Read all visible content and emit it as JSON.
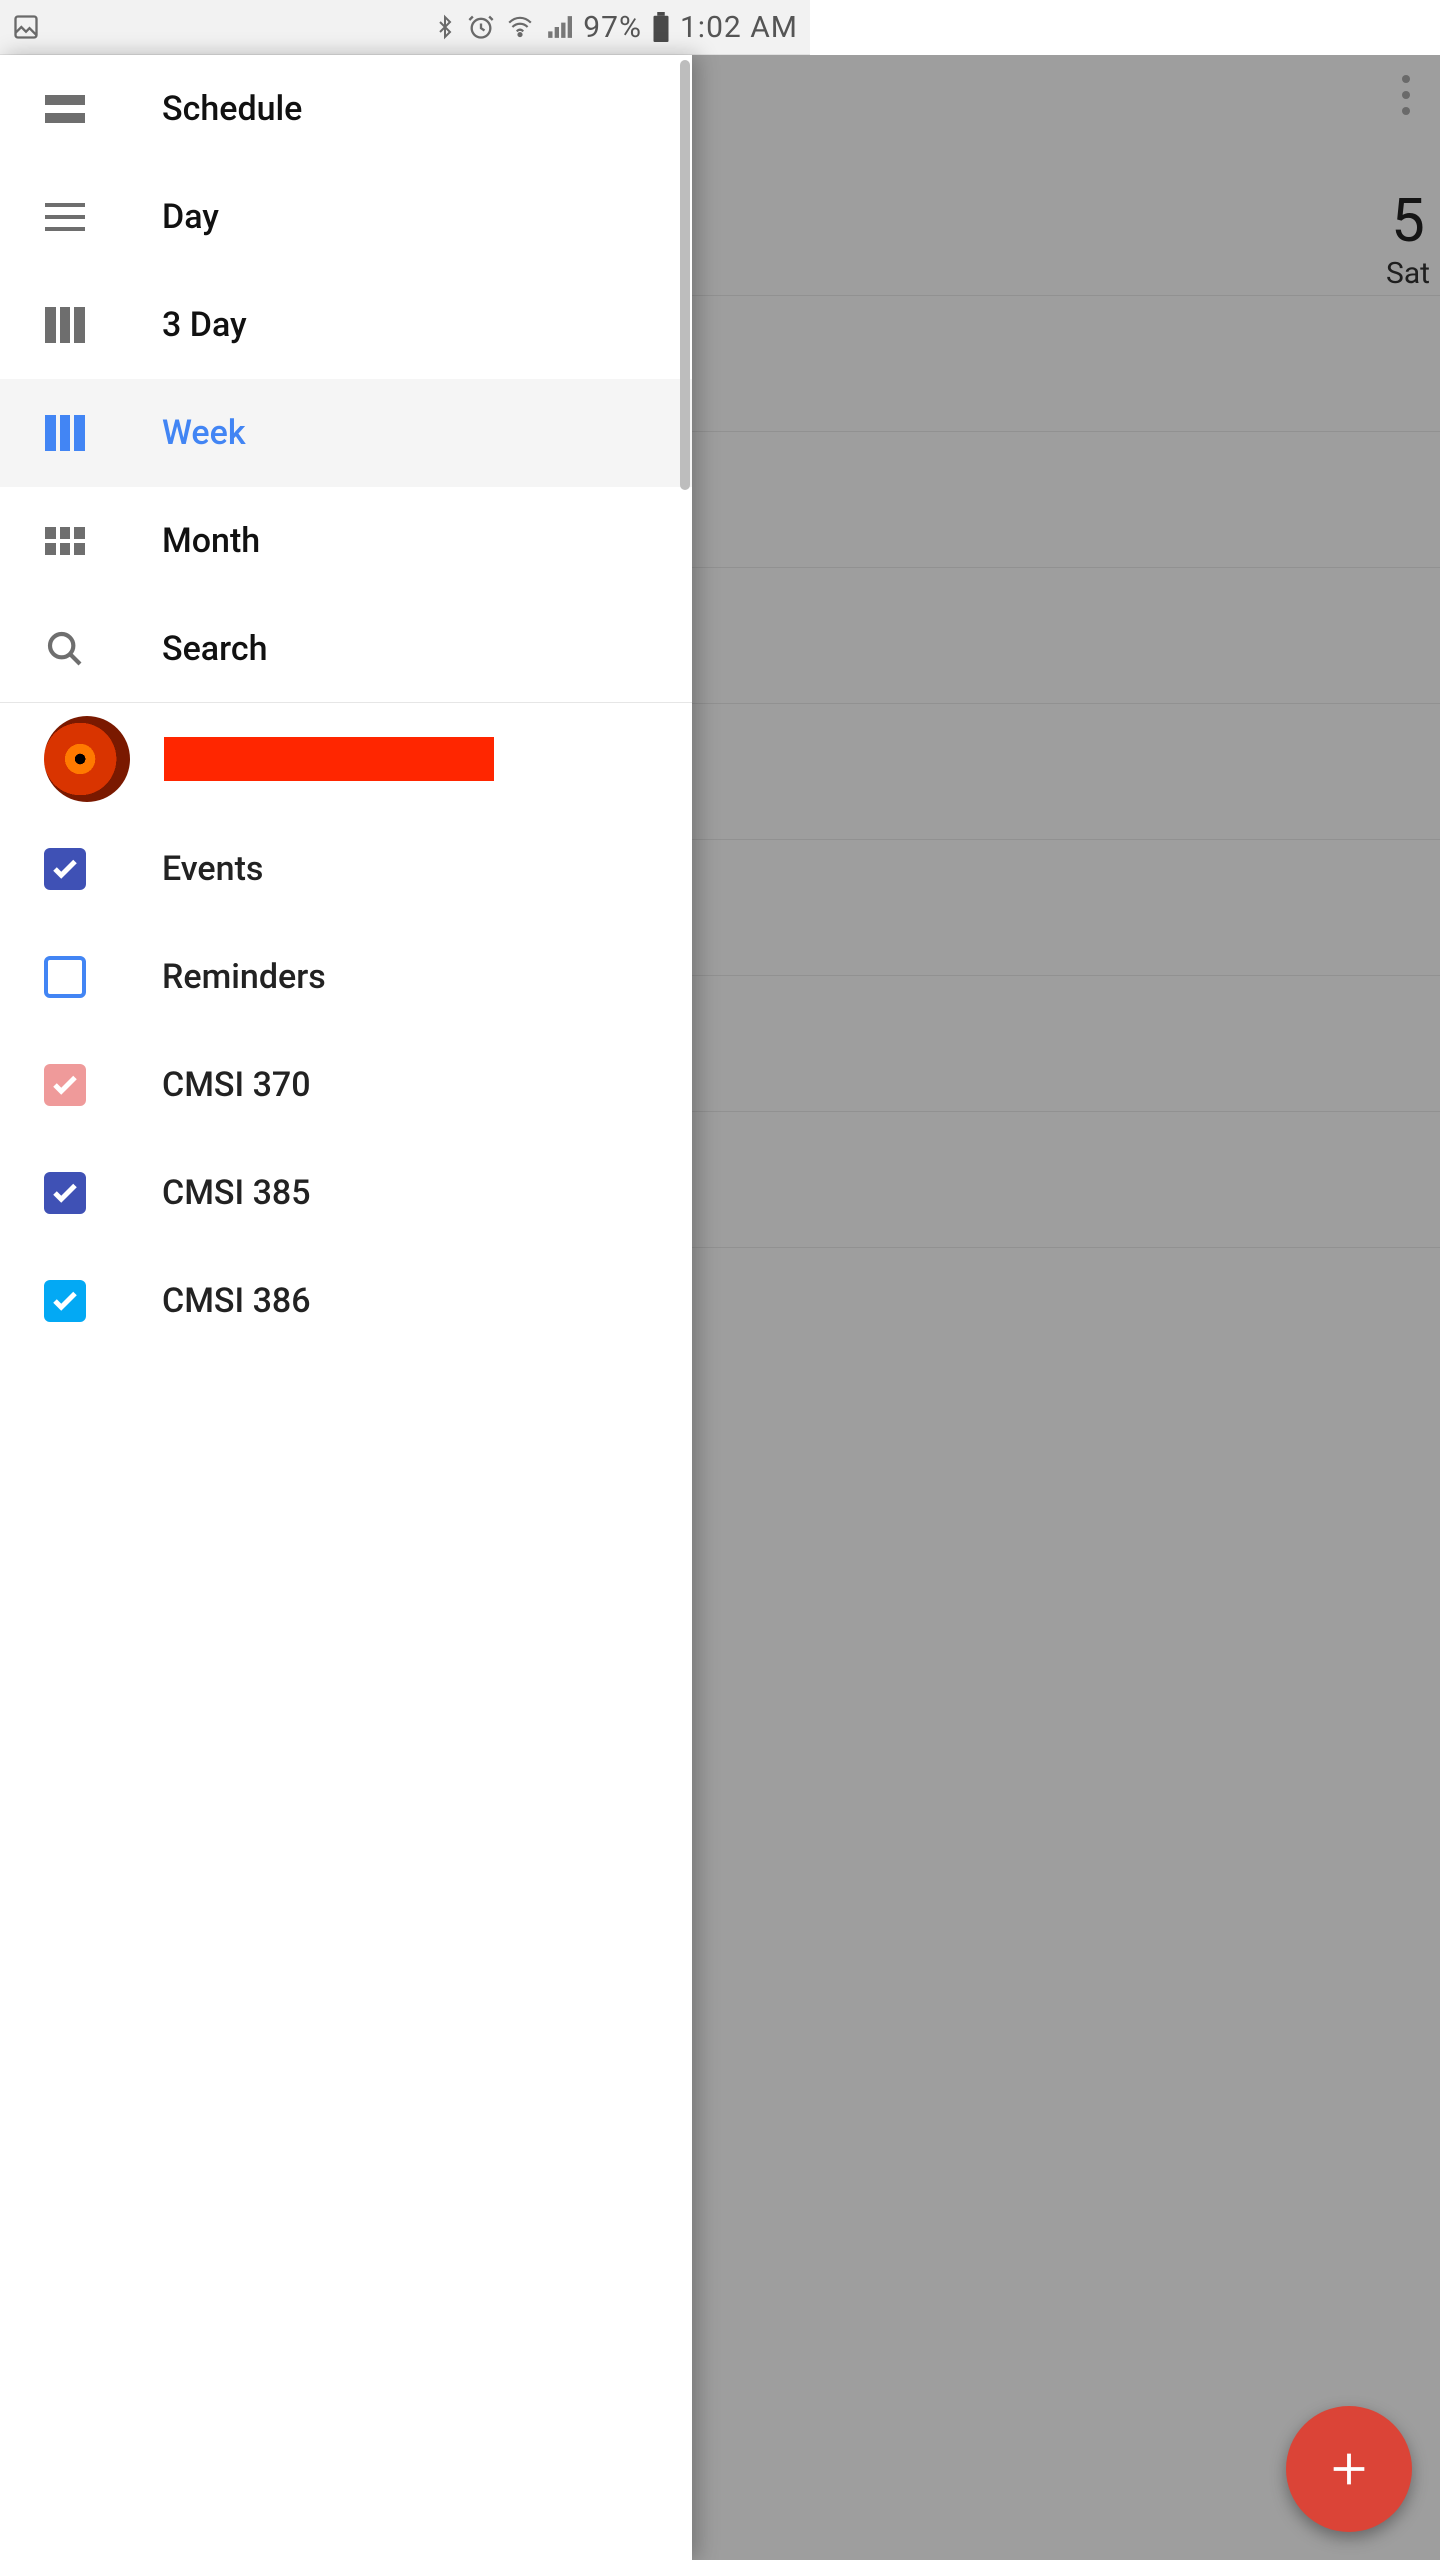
{
  "status": {
    "battery_pct": "97%",
    "time": "1:02 AM"
  },
  "background": {
    "day_num": "5",
    "day_name": "Sat"
  },
  "drawer": {
    "views": [
      {
        "id": "schedule",
        "label": "Schedule",
        "icon": "schedule",
        "selected": false
      },
      {
        "id": "day",
        "label": "Day",
        "icon": "day",
        "selected": false
      },
      {
        "id": "3day",
        "label": "3 Day",
        "icon": "3day",
        "selected": false
      },
      {
        "id": "week",
        "label": "Week",
        "icon": "week",
        "selected": true
      },
      {
        "id": "month",
        "label": "Month",
        "icon": "month",
        "selected": false
      },
      {
        "id": "search",
        "label": "Search",
        "icon": "search",
        "selected": false
      }
    ],
    "account": {
      "avatar": "eye-of-sauron",
      "name_redacted": true
    },
    "calendars": [
      {
        "label": "Events",
        "checked": true,
        "color": "#3f51b5"
      },
      {
        "label": "Reminders",
        "checked": false,
        "color": "#4285f4"
      },
      {
        "label": "CMSI 370",
        "checked": true,
        "color": "#ef9a9a"
      },
      {
        "label": "CMSI 385",
        "checked": true,
        "color": "#3f51b5"
      },
      {
        "label": "CMSI 386",
        "checked": true,
        "color": "#03a9f4"
      }
    ]
  }
}
